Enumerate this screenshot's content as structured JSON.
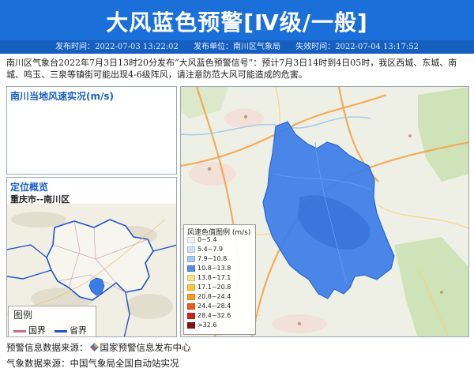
{
  "header": {
    "title": "大风蓝色预警[Ⅳ级/一般]",
    "issue_time_label": "发布时间：",
    "issue_time": "2022-07-03 13:22:02",
    "issuer_label": "发布单位：",
    "issuer": "南川区气象局",
    "expire_label": "失效时间：",
    "expire_time": "2022-07-04 13:17:52"
  },
  "colors": {
    "banner": "#1a6fd8",
    "meta_bar": "#155fc0",
    "warning_area": "#3b7de8",
    "panel_title": "#1a5fc7"
  },
  "description": "南川区气象台2022年7月3日13时20分发布“大风蓝色预警信号”：预计7月3日14时到4日05时，我区西城、东城、南城、鸣玉、三泉等镇街可能出现4-6级阵风，请注意防范大风可能造成的危害。",
  "wind_panel": {
    "title": "南川当地风速实况(m/s)"
  },
  "location_panel": {
    "title": "定位概览",
    "subtitle": "重庆市--南川区",
    "legend": {
      "title": "图例",
      "items": [
        {
          "label": "国界",
          "color": "#c86d8c"
        },
        {
          "label": "省界",
          "color": "#1f55c8"
        }
      ]
    }
  },
  "wind_legend": {
    "title": "风速色值图例 (m/s)",
    "items": [
      {
        "label": "0~5.4",
        "color": "#eef2f7"
      },
      {
        "label": "5.4~7.9",
        "color": "#cfe2f7"
      },
      {
        "label": "7.9~10.8",
        "color": "#a4c9f2"
      },
      {
        "label": "10.8~13.8",
        "color": "#4f8de6"
      },
      {
        "label": "13.8~17.1",
        "color": "#ffe08a"
      },
      {
        "label": "17.1~20.8",
        "color": "#ffc23a"
      },
      {
        "label": "20.8~24.4",
        "color": "#ff9a1e"
      },
      {
        "label": "24.4~28.4",
        "color": "#ee5a19"
      },
      {
        "label": "28.4~32.6",
        "color": "#c8261a"
      },
      {
        "label": ">32.6",
        "color": "#8a0f0f"
      }
    ]
  },
  "footer": {
    "source_label": "预警信息数据来源：",
    "source_name": "国家预警信息发布中心",
    "weather_label": "气象数据来源：",
    "weather_name": "中国气象局全国自动站实况"
  }
}
